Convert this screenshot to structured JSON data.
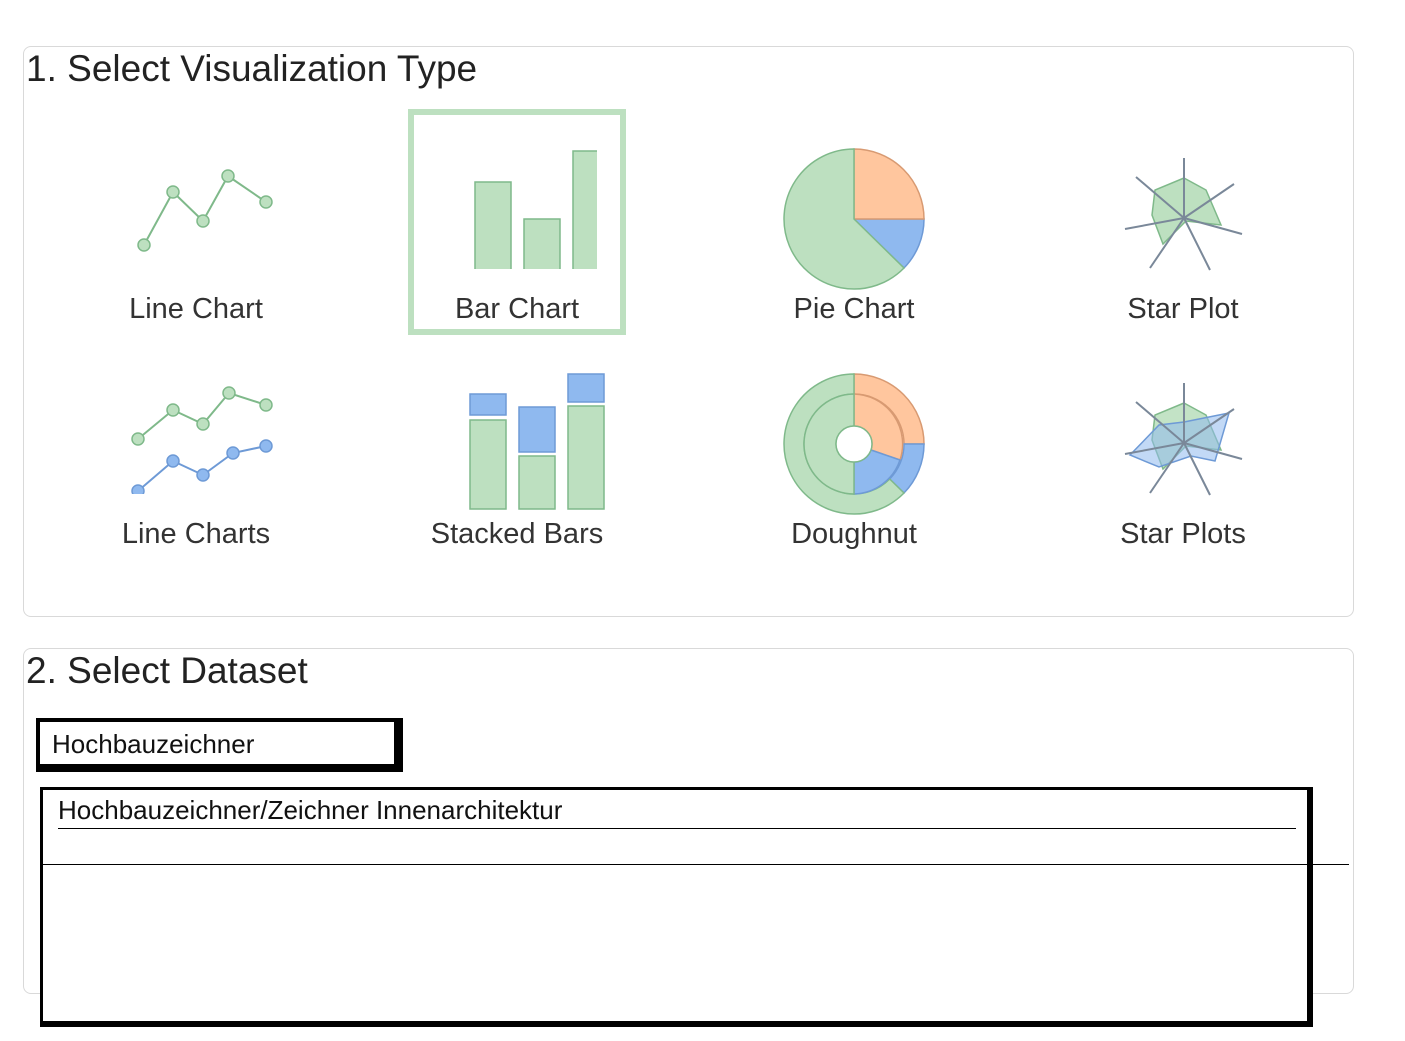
{
  "visualization": {
    "title": "1. Select Visualization Type",
    "options": [
      {
        "label": "Line Chart",
        "icon": "line-chart-icon",
        "selected": false
      },
      {
        "label": "Bar Chart",
        "icon": "bar-chart-icon",
        "selected": true
      },
      {
        "label": "Pie Chart",
        "icon": "pie-chart-icon",
        "selected": false
      },
      {
        "label": "Star Plot",
        "icon": "star-plot-icon",
        "selected": false
      },
      {
        "label": "Line Charts",
        "icon": "multi-line-chart-icon",
        "selected": false
      },
      {
        "label": "Stacked Bars",
        "icon": "stacked-bar-chart-icon",
        "selected": false
      },
      {
        "label": "Doughnut",
        "icon": "doughnut-chart-icon",
        "selected": false
      },
      {
        "label": "Star Plots",
        "icon": "multi-star-plot-icon",
        "selected": false
      }
    ]
  },
  "dataset": {
    "title": "2. Select Dataset",
    "search_value": "Hochbauzeichner",
    "results": [
      "Hochbauzeichner/Zeichner Innenarchitektur"
    ]
  },
  "colors": {
    "green_fill": "#bde0c0",
    "green_stroke": "#7fb98a",
    "blue_fill": "#8fb9ef",
    "blue_stroke": "#6e9ad6",
    "orange_fill": "#ffc69e",
    "orange_stroke": "#d89a72",
    "selection_border": "#bde0c0",
    "axis_gray": "#7a8899"
  }
}
